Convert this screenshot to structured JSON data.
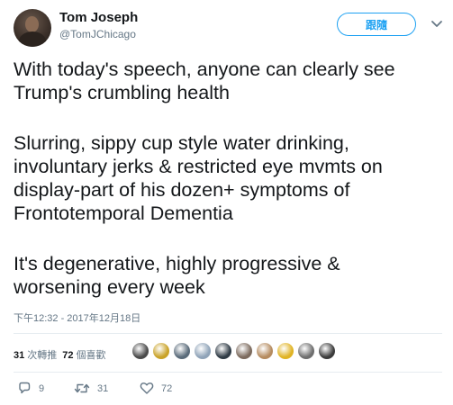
{
  "author": {
    "name": "Tom Joseph",
    "handle": "@TomJChicago"
  },
  "follow_button": {
    "label": "跟隨"
  },
  "tweet": {
    "paragraphs": [
      [
        "With today's speech, anyone can clearly see",
        "Trump's crumbling health"
      ],
      [
        "Slurring, sippy cup style water drinking,",
        "involuntary jerks & restricted eye mvmts on",
        "display-part of his dozen+ symptoms of",
        "Frontotemporal Dementia"
      ],
      [
        "It's degenerative, highly progressive &",
        "worsening every week"
      ]
    ],
    "timestamp": "下午12:32 - 2017年12月18日"
  },
  "stats": {
    "retweets_count": "31",
    "retweets_label": "次轉推",
    "likes_count": "72",
    "likes_label": "個喜歡"
  },
  "likers": [
    {
      "icon": "liker-avatar",
      "color": "#4a4a4a"
    },
    {
      "icon": "liker-avatar",
      "color": "#c9a227"
    },
    {
      "icon": "liker-avatar",
      "color": "#5a6b7a"
    },
    {
      "icon": "liker-avatar",
      "color": "#8fa3b8"
    },
    {
      "icon": "liker-avatar",
      "color": "#2f3b45"
    },
    {
      "icon": "liker-avatar",
      "color": "#7c6a5d"
    },
    {
      "icon": "liker-avatar",
      "color": "#b58b5f"
    },
    {
      "icon": "liker-avatar",
      "color": "#e0b324"
    },
    {
      "icon": "liker-avatar",
      "color": "#6e6e6e"
    },
    {
      "icon": "liker-avatar",
      "color": "#3b3b3b"
    }
  ],
  "actions": {
    "reply_count": "9",
    "retweet_count": "31",
    "like_count": "72"
  },
  "colors": {
    "accent": "#1da1f2",
    "text": "#14171a",
    "muted": "#657786",
    "divider": "#e6ecf0"
  }
}
